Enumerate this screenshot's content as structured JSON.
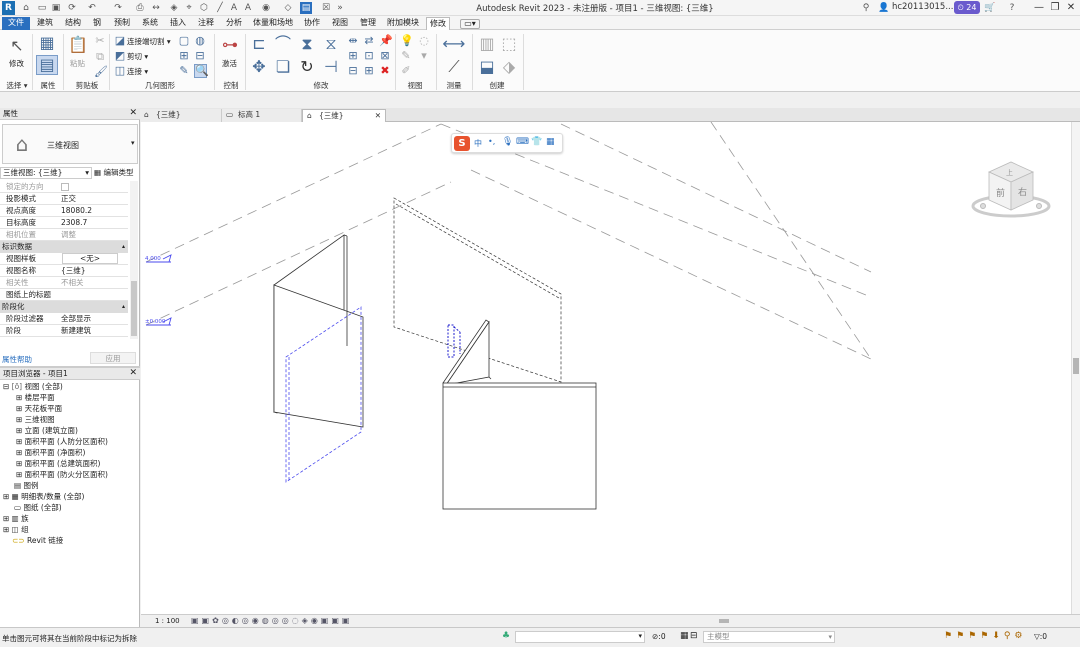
{
  "titlebar": {
    "app_logo": "R",
    "window_title": "Autodesk Revit 2023 - 未注册版 - 项目1 - 三维视图: {三维}",
    "user_name": "hc20113015...",
    "badge_count": "24"
  },
  "menu": {
    "tabs": [
      "文件",
      "建筑",
      "结构",
      "钢",
      "预制",
      "系统",
      "插入",
      "注释",
      "分析",
      "体量和场地",
      "协作",
      "视图",
      "管理",
      "附加模块",
      "修改"
    ]
  },
  "ribbon": {
    "groups": {
      "select": "选择",
      "properties": "属性",
      "clipboard": "剪贴板",
      "geometry": "几何图形",
      "control": "控制",
      "modify": "修改",
      "view": "视图",
      "measure": "测量",
      "create": "创建"
    },
    "modify_label": "修改",
    "paste_label": "粘贴",
    "join_cut_label": "连接端切割",
    "cut_label": "剪切",
    "join_label": "连接",
    "activate_label": "激活"
  },
  "properties": {
    "header": "属性",
    "type_name": "三维视图",
    "type_selector": "三维视图: {三维}",
    "edit_type": "编辑类型",
    "rows": [
      {
        "k": "锁定的方向",
        "v": "",
        "grey": true
      },
      {
        "k": "投影模式",
        "v": "正交",
        "grey": false
      },
      {
        "k": "视点高度",
        "v": "18080.2",
        "grey": false
      },
      {
        "k": "目标高度",
        "v": "2308.7",
        "grey": false
      },
      {
        "k": "相机位置",
        "v": "调整",
        "grey": true
      }
    ],
    "section_identity": "标识数据",
    "identity_rows": [
      {
        "k": "视图样板",
        "v": "<无>",
        "grey": false
      },
      {
        "k": "视图名称",
        "v": "{三维}",
        "grey": false
      },
      {
        "k": "相关性",
        "v": "不相关",
        "grey": true
      },
      {
        "k": "图纸上的标题",
        "v": "",
        "grey": false
      }
    ],
    "section_phasing": "阶段化",
    "phasing_rows": [
      {
        "k": "阶段过滤器",
        "v": "全部显示",
        "grey": false
      },
      {
        "k": "阶段",
        "v": "新建建筑",
        "grey": false
      }
    ],
    "help_link": "属性帮助",
    "apply_button": "应用"
  },
  "browser": {
    "header": "项目浏览器 - 项目1",
    "items": [
      "视图 (全部)",
      "楼层平面",
      "天花板平面",
      "三维视图",
      "立面 (建筑立面)",
      "面积平面 (人防分区面积)",
      "面积平面 (净面积)",
      "面积平面 (总建筑面积)",
      "面积平面 (防火分区面积)",
      "图例",
      "明细表/数量 (全部)",
      "图纸 (全部)",
      "族",
      "组",
      "Revit 链接"
    ]
  },
  "viewtabs": [
    "{三维}",
    "标高 1",
    "{三维}"
  ],
  "viewcube": {
    "front": "前",
    "right": "右",
    "top": "上"
  },
  "levels": [
    "4.000",
    "±0.000"
  ],
  "view_control": {
    "scale": "1 : 100"
  },
  "status": {
    "message": "单击图元可将其在当前阶段中标记为拆除",
    "count1": ":0",
    "model_label": "主模型",
    "filter_count": ":0"
  },
  "colors": {
    "accent": "#2a6fbf",
    "select_blue": "#1f1fcf"
  }
}
